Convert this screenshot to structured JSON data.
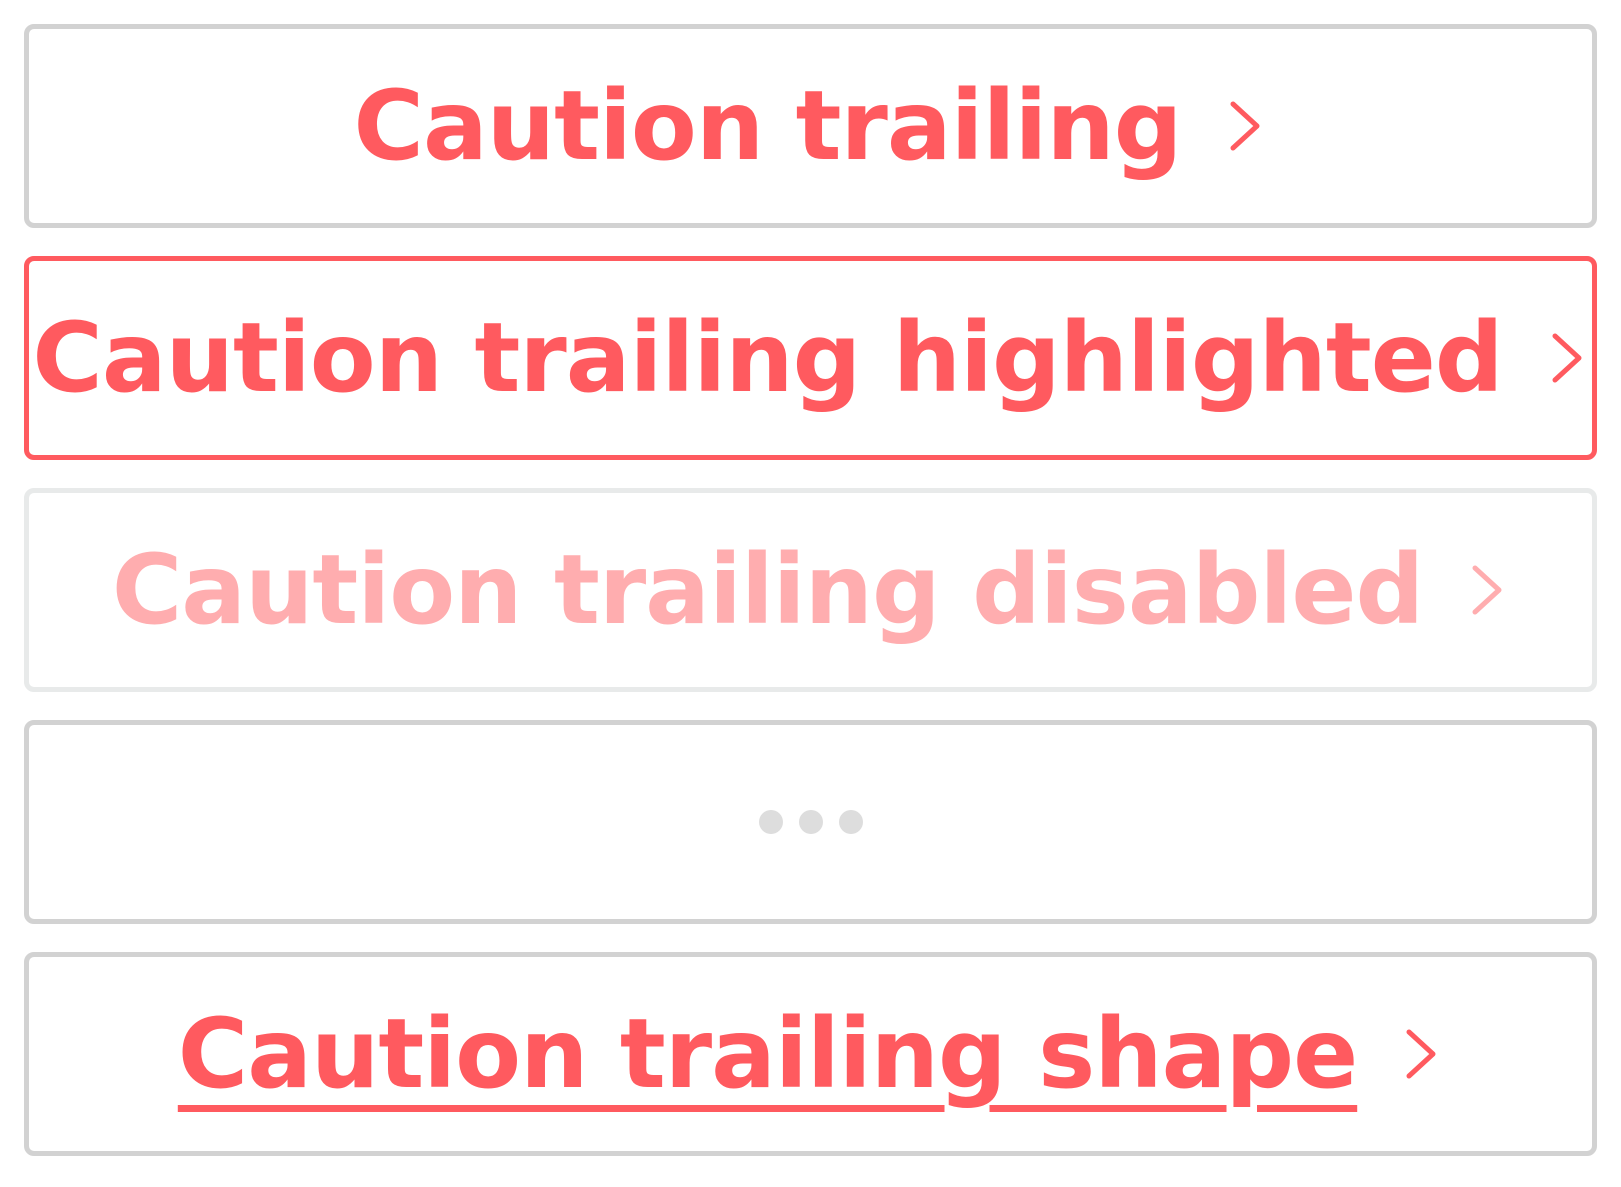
{
  "colors": {
    "accent": "#ff5a5f",
    "accent_disabled": "#ffadaf",
    "border_default": "#d2d2d2",
    "border_disabled": "#e8eaea",
    "loading_dot": "#dddddd"
  },
  "buttons": [
    {
      "label": "Caution trailing",
      "state": "default",
      "icon": "chevron-right-icon"
    },
    {
      "label": "Caution trailing highlighted",
      "state": "highlighted",
      "icon": "chevron-right-icon"
    },
    {
      "label": "Caution trailing disabled",
      "state": "disabled",
      "icon": "chevron-right-icon"
    },
    {
      "label": "",
      "state": "loading",
      "icon": "loading-dots-icon"
    },
    {
      "label": "Caution trailing shape",
      "state": "shape",
      "icon": "chevron-right-icon"
    }
  ]
}
